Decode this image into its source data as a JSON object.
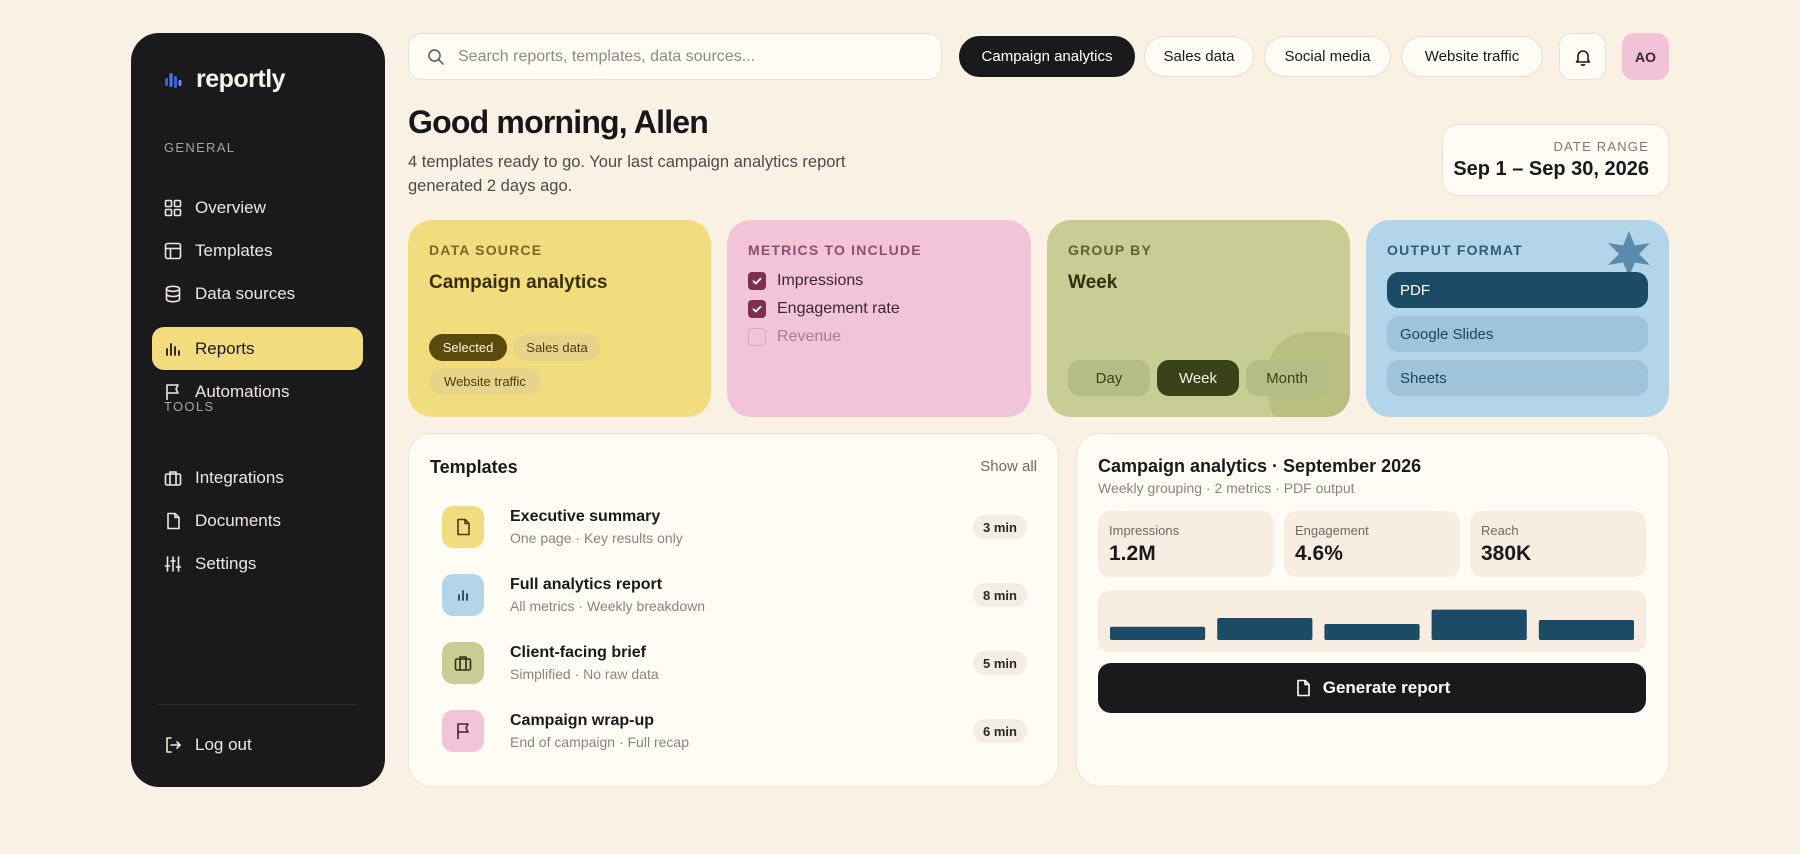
{
  "app": {
    "name": "reportly"
  },
  "sidebar": {
    "general_label": "GENERAL",
    "tools_label": "TOOLS",
    "general_items": [
      {
        "label": "Overview",
        "icon": "grid-icon"
      },
      {
        "label": "Templates",
        "icon": "layout-icon"
      },
      {
        "label": "Data sources",
        "icon": "database-icon"
      },
      {
        "label": "Reports",
        "icon": "bar-chart-icon",
        "active": true
      },
      {
        "label": "Automations",
        "icon": "flag-icon"
      }
    ],
    "tool_items": [
      {
        "label": "Integrations",
        "icon": "briefcase-icon"
      },
      {
        "label": "Documents",
        "icon": "document-icon"
      },
      {
        "label": "Settings",
        "icon": "sliders-icon"
      }
    ],
    "logout_label": "Log out"
  },
  "search": {
    "placeholder": "Search reports, templates, data sources...",
    "value": ""
  },
  "filters": [
    {
      "label": "Campaign analytics",
      "active": true
    },
    {
      "label": "Sales data",
      "active": false
    },
    {
      "label": "Social media",
      "active": false
    },
    {
      "label": "Website traffic",
      "active": false
    }
  ],
  "user": {
    "initials": "AO"
  },
  "greeting": {
    "title": "Good morning, Allen",
    "subtitle": "4 templates ready to go. Your last campaign analytics report generated 2 days ago."
  },
  "date_range": {
    "label": "DATE RANGE",
    "value": "Sep 1 – Sep 30, 2026"
  },
  "data_source": {
    "label": "DATA SOURCE",
    "value": "Campaign analytics",
    "pills": [
      "Selected",
      "Sales data",
      "Website traffic"
    ]
  },
  "metrics": {
    "label": "METRICS TO INCLUDE",
    "items": [
      {
        "label": "Impressions",
        "checked": true
      },
      {
        "label": "Engagement rate",
        "checked": true
      },
      {
        "label": "Revenue",
        "checked": false
      }
    ]
  },
  "group_by": {
    "label": "GROUP BY",
    "value": "Week",
    "options": [
      "Day",
      "Week",
      "Month"
    ],
    "selected": "Week"
  },
  "output_format": {
    "label": "OUTPUT FORMAT",
    "options": [
      "PDF",
      "Google Slides",
      "Sheets"
    ],
    "selected": "PDF"
  },
  "templates": {
    "title": "Templates",
    "show_all": "Show all",
    "items": [
      {
        "name": "Executive summary",
        "desc": "One page · Key results only",
        "time": "3 min",
        "icon": "document-icon",
        "color": "#F1DD7E"
      },
      {
        "name": "Full analytics report",
        "desc": "All metrics · Weekly breakdown",
        "time": "8 min",
        "icon": "bar-chart-icon",
        "color": "#B3D5EA"
      },
      {
        "name": "Client-facing brief",
        "desc": "Simplified · No raw data",
        "time": "5 min",
        "icon": "briefcase-icon",
        "color": "#C8CE93"
      },
      {
        "name": "Campaign wrap-up",
        "desc": "End of campaign · Full recap",
        "time": "6 min",
        "icon": "flag-icon",
        "color": "#F2C4D7"
      }
    ]
  },
  "preview": {
    "title": "Campaign analytics · September 2026",
    "subtitle": "Weekly grouping · 2 metrics · PDF output",
    "metrics": [
      {
        "label": "Impressions",
        "value": "1.2M"
      },
      {
        "label": "Engagement",
        "value": "4.6%"
      },
      {
        "label": "Reach",
        "value": "380K"
      }
    ],
    "bars": [
      0.33,
      0.55,
      0.4,
      0.76,
      0.5
    ],
    "generate_label": "Generate report"
  },
  "colors": {
    "background": "#FAF1E5",
    "sidebar": "#1A1A1D",
    "accent_yellow": "#F1DD7E",
    "accent_pink": "#F2C4D7",
    "accent_green": "#C8CE93",
    "accent_blue": "#B3D5EA",
    "bar_fill": "#1C4B66"
  }
}
